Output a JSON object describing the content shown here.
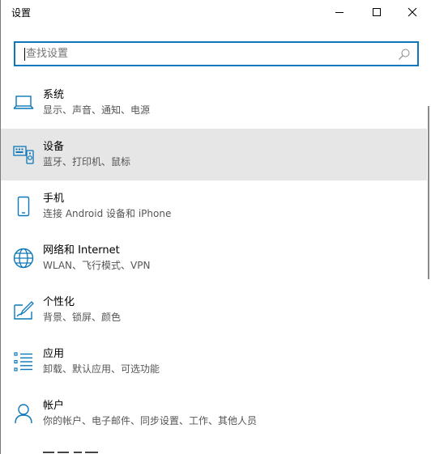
{
  "window": {
    "title": "设置"
  },
  "search": {
    "placeholder": "查找设置"
  },
  "items": [
    {
      "name": "系统",
      "desc": "显示、声音、通知、电源",
      "icon": "laptop-icon"
    },
    {
      "name": "设备",
      "desc": "蓝牙、打印机、鼠标",
      "icon": "keyboard-devices-icon",
      "selected": true
    },
    {
      "name": "手机",
      "desc": "连接 Android 设备和 iPhone",
      "icon": "phone-icon"
    },
    {
      "name": "网络和 Internet",
      "desc": "WLAN、飞行模式、VPN",
      "icon": "globe-icon"
    },
    {
      "name": "个性化",
      "desc": "背景、锁屏、颜色",
      "icon": "personalization-icon"
    },
    {
      "name": "应用",
      "desc": "卸载、默认应用、可选功能",
      "icon": "apps-list-icon"
    },
    {
      "name": "帐户",
      "desc": "你的帐户、电子邮件、同步设置、工作、其他人员",
      "icon": "person-icon"
    }
  ],
  "colors": {
    "accent": "#0c77b9",
    "selected_bg": "#e6e6e6",
    "secondary_text": "#555555"
  }
}
